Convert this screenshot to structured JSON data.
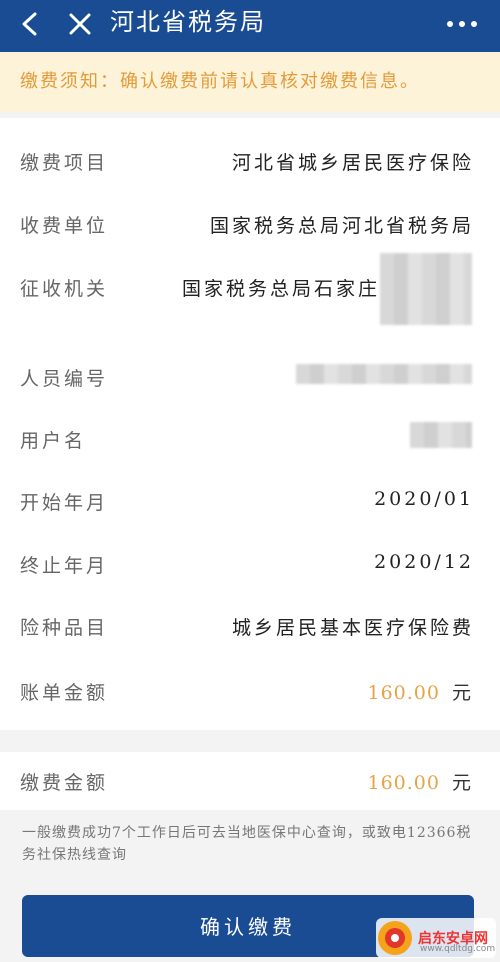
{
  "header": {
    "title": "河北省税务局",
    "back_icon": "back-arrow-icon",
    "close_icon": "close-icon",
    "more_icon": "more-dots-icon"
  },
  "notice": {
    "text": "缴费须知：确认缴费前请认真核对缴费信息。"
  },
  "details": {
    "rows": [
      {
        "label": "缴费项目",
        "value": "河北省城乡居民医疗保险"
      },
      {
        "label": "收费单位",
        "value": "国家税务总局河北省税务局"
      },
      {
        "label": "征收机关",
        "value": "国家税务总局石家庄"
      },
      {
        "label": "人员编号",
        "value": ""
      },
      {
        "label": "用户名",
        "value": ""
      },
      {
        "label": "开始年月",
        "value": "2020/01"
      },
      {
        "label": "终止年月",
        "value": "2020/12"
      },
      {
        "label": "险种品目",
        "value": "城乡居民基本医疗保险费"
      },
      {
        "label": "账单金额",
        "value": "160.00",
        "unit": "元"
      }
    ]
  },
  "payment": {
    "label": "缴费金额",
    "value": "160.00",
    "unit": "元"
  },
  "footnote": "一般缴费成功7个工作日后可去当地医保中心查询，或致电12366税务社保热线查询",
  "confirm_button": "确认缴费",
  "watermark": {
    "text": "启东安卓网",
    "sub": "www.qdltdg.com"
  },
  "colors": {
    "header_bg": "#1a4c93",
    "notice_bg": "#fdf3d8",
    "notice_text": "#e59a3a",
    "amount": "#e5a447"
  }
}
